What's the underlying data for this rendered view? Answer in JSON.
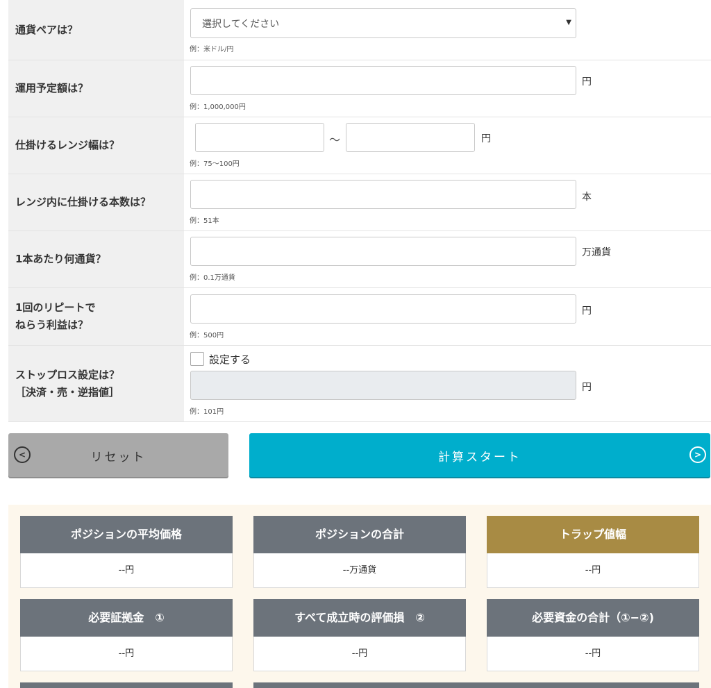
{
  "form": {
    "currency_pair": {
      "label": "通貨ペアは？",
      "selected": "選択してください",
      "hint": "例：米ドル/円"
    },
    "amount": {
      "label": "運用予定額は？",
      "value": "",
      "unit": "円",
      "hint": "例：1,000,000円"
    },
    "range": {
      "label": "仕掛けるレンジ幅は？",
      "from": "",
      "to": "",
      "separator": "～",
      "unit": "円",
      "hint": "例：75～100円"
    },
    "count": {
      "label": "レンジ内に仕掛ける本数は？",
      "value": "",
      "unit": "本",
      "hint": "例：51本"
    },
    "lot": {
      "label": "1本あたり何通貨？",
      "value": "",
      "unit": "万通貨",
      "hint": "例：0.1万通貨"
    },
    "profit": {
      "label": "1回のリピートで\nねらう利益は？",
      "value": "",
      "unit": "円",
      "hint": "例：500円"
    },
    "stoploss": {
      "label": "ストップロス設定は？\n［決済・売・逆指値］",
      "checkbox_label": "設定する",
      "checked": false,
      "value": "",
      "unit": "円",
      "hint": "例：101円"
    }
  },
  "buttons": {
    "reset": "リセット",
    "calculate": "計算スタート"
  },
  "results": [
    {
      "title": "ポジションの平均価格",
      "value": "--円",
      "accent": "#6c737b"
    },
    {
      "title": "ポジションの合計",
      "value": "--万通貨",
      "accent": "#6c737b"
    },
    {
      "title": "トラップ値幅",
      "value": "--円",
      "accent": "#a88b44"
    },
    {
      "title": "必要証拠金　①",
      "value": "--円",
      "accent": "#6c737b"
    },
    {
      "title": "すべて成立時の評価損　②",
      "value": "--円",
      "accent": "#6c737b"
    },
    {
      "title": "必要資金の合計（①−②)",
      "value": "--円",
      "accent": "#6c737b"
    }
  ]
}
